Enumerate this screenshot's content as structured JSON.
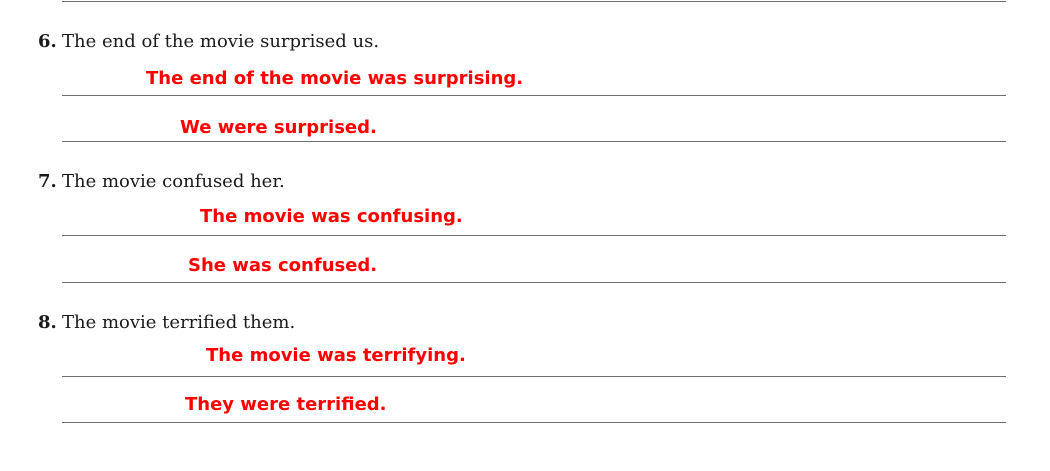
{
  "exercises": [
    {
      "number": "6.",
      "sentence": "The end of the movie surprised us.",
      "answers": [
        "The end of the movie was surprising.",
        "We were surprised."
      ]
    },
    {
      "number": "7.",
      "sentence": "The movie confused her.",
      "answers": [
        "The movie was confusing.",
        "She was confused."
      ]
    },
    {
      "number": "8.",
      "sentence": "The movie terrified them.",
      "answers": [
        "The movie was terrifying.",
        "They were terrified."
      ]
    }
  ],
  "colors": {
    "answer": "#ff0000",
    "text": "#1a1a1a",
    "rule": "#6f6f6f"
  }
}
